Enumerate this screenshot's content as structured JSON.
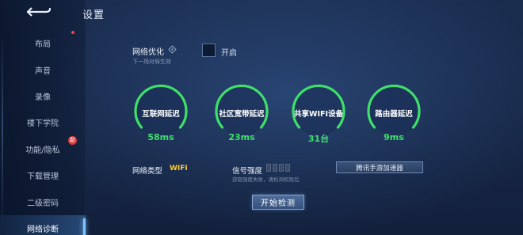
{
  "header": {
    "title": "设置"
  },
  "sidebar": {
    "items": [
      {
        "label": "布局",
        "red_dot": true,
        "badge": ""
      },
      {
        "label": "声音",
        "red_dot": false,
        "badge": ""
      },
      {
        "label": "录像",
        "red_dot": false,
        "badge": ""
      },
      {
        "label": "楼下学院",
        "red_dot": false,
        "badge": ""
      },
      {
        "label": "功能/隐私",
        "red_dot": false,
        "badge": "新"
      },
      {
        "label": "下载管理",
        "red_dot": false,
        "badge": ""
      },
      {
        "label": "二级密码",
        "red_dot": false,
        "badge": ""
      },
      {
        "label": "网络诊断",
        "red_dot": false,
        "badge": "",
        "active": true
      }
    ]
  },
  "optimize": {
    "label": "网络优化",
    "sub": "下一场对局生效",
    "toggle_label": "开启",
    "checked": false
  },
  "gauges": [
    {
      "name": "互联网延迟",
      "value": "58ms"
    },
    {
      "name": "社区宽带延迟",
      "value": "23ms"
    },
    {
      "name": "共享WIFI设备",
      "value": "31台"
    },
    {
      "name": "路由器延迟",
      "value": "9ms"
    }
  ],
  "network": {
    "type_label": "网络类型",
    "type_value": "WIFI",
    "signal_label": "信号强度",
    "signal_sub": "获取强度失败，请检测权限后",
    "signal_level": 0
  },
  "buttons": {
    "accelerator": "腾讯手游加速器",
    "start": "开始检测"
  },
  "colors": {
    "accent_green": "#3fe06a",
    "wifi_yellow": "#ffcc2e",
    "badge_red": "#e33a3a"
  }
}
